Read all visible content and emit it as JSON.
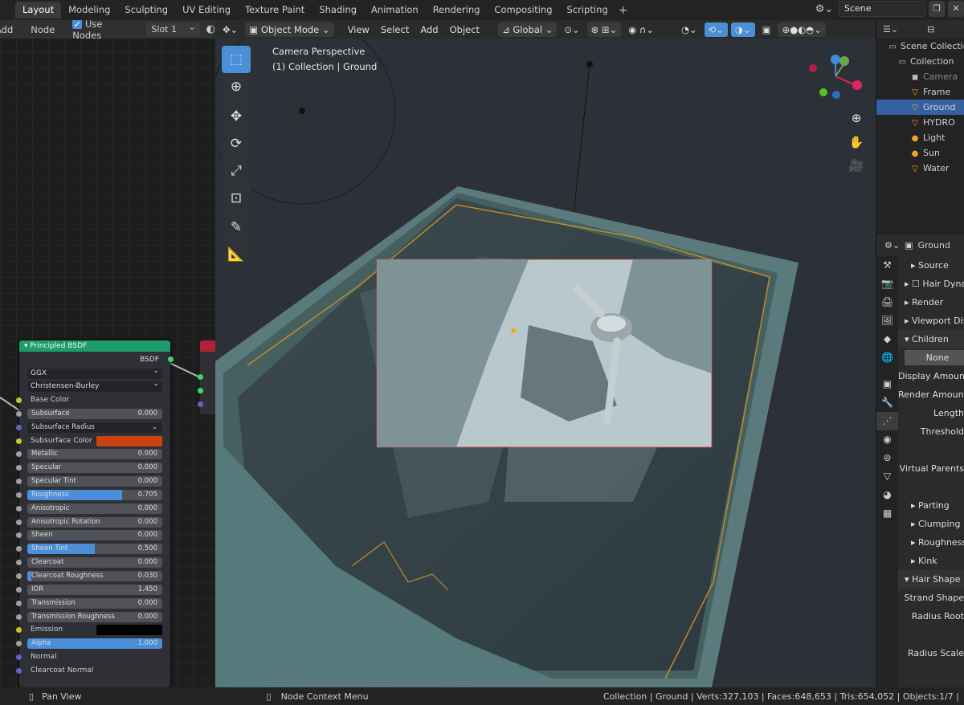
{
  "workspace_tabs": [
    "Layout",
    "Modeling",
    "Sculpting",
    "UV Editing",
    "Texture Paint",
    "Shading",
    "Animation",
    "Rendering",
    "Compositing",
    "Scripting"
  ],
  "active_tab": "Layout",
  "scene_name": "Scene",
  "node_editor": {
    "menu_add": "Add",
    "menu_node": "Node",
    "use_nodes_label": "Use Nodes",
    "slot": "Slot 1"
  },
  "node": {
    "title": "Principled BSDF",
    "output": "BSDF",
    "distribution": "GGX",
    "subsurface_method": "Christensen-Burley",
    "inputs": [
      {
        "type": "label",
        "label": "Base Color",
        "sock": "#c7c729"
      },
      {
        "type": "bar",
        "label": "Subsurface",
        "value": "0.000",
        "fill": 0,
        "sock": "#a1a1a1"
      },
      {
        "type": "dd",
        "label": "Subsurface Radius",
        "value": "",
        "sock": "#6363c7"
      },
      {
        "type": "color",
        "label": "Subsurface Color",
        "color": "#c9440f",
        "sock": "#c7c729"
      },
      {
        "type": "bar",
        "label": "Metallic",
        "value": "0.000",
        "fill": 0,
        "sock": "#a1a1a1"
      },
      {
        "type": "bar",
        "label": "Specular",
        "value": "0.000",
        "fill": 0,
        "sock": "#a1a1a1"
      },
      {
        "type": "bar",
        "label": "Specular Tint",
        "value": "0.000",
        "fill": 0,
        "sock": "#a1a1a1"
      },
      {
        "type": "bar",
        "label": "Roughness",
        "value": "0.705",
        "fill": 0.705,
        "sock": "#a1a1a1"
      },
      {
        "type": "bar",
        "label": "Anisotropic",
        "value": "0.000",
        "fill": 0,
        "sock": "#a1a1a1"
      },
      {
        "type": "bar",
        "label": "Anisotropic Rotation",
        "value": "0.000",
        "fill": 0,
        "sock": "#a1a1a1"
      },
      {
        "type": "bar",
        "label": "Sheen",
        "value": "0.000",
        "fill": 0,
        "sock": "#a1a1a1"
      },
      {
        "type": "bar",
        "label": "Sheen Tint",
        "value": "0.500",
        "fill": 0.5,
        "sock": "#a1a1a1"
      },
      {
        "type": "bar",
        "label": "Clearcoat",
        "value": "0.000",
        "fill": 0,
        "sock": "#a1a1a1"
      },
      {
        "type": "bar",
        "label": "Clearcoat Roughness",
        "value": "0.030",
        "fill": 0.03,
        "sock": "#a1a1a1"
      },
      {
        "type": "bar",
        "label": "IOR",
        "value": "1.450",
        "fill": 0,
        "sock": "#a1a1a1"
      },
      {
        "type": "bar",
        "label": "Transmission",
        "value": "0.000",
        "fill": 0,
        "sock": "#a1a1a1"
      },
      {
        "type": "bar",
        "label": "Transmission Roughness",
        "value": "0.000",
        "fill": 0,
        "sock": "#a1a1a1"
      },
      {
        "type": "color",
        "label": "Emission",
        "color": "#000000",
        "sock": "#c7c729"
      },
      {
        "type": "bar",
        "label": "Alpha",
        "value": "1.000",
        "fill": 1,
        "sock": "#a1a1a1"
      },
      {
        "type": "label",
        "label": "Normal",
        "sock": "#6363c7"
      },
      {
        "type": "label",
        "label": "Clearcoat Normal",
        "sock": "#6363c7"
      }
    ]
  },
  "viewport": {
    "mode": "Object Mode",
    "menu": [
      "View",
      "Select",
      "Add",
      "Object"
    ],
    "orientation": "Global",
    "perspective_label": "Camera Perspective",
    "collection_label": "(1) Collection | Ground"
  },
  "outliner": {
    "items": [
      {
        "label": "Scene Collection",
        "icon": "▭"
      },
      {
        "label": "Collection",
        "icon": "▭"
      },
      {
        "label": "Camera",
        "icon": "◼",
        "dim": true
      },
      {
        "label": "Frame",
        "icon": "▽"
      },
      {
        "label": "Ground",
        "icon": "▽",
        "selected": true
      },
      {
        "label": "HYDRO",
        "icon": "▽"
      },
      {
        "label": "Light",
        "icon": "●"
      },
      {
        "label": "Sun",
        "icon": "●"
      },
      {
        "label": "Water",
        "icon": "▽"
      }
    ]
  },
  "properties": {
    "object_name": "Ground",
    "rows": [
      {
        "label": "Source",
        "kind": "sub"
      },
      {
        "label": "Hair Dynamics",
        "kind": "check"
      },
      {
        "label": "Render",
        "kind": "sec"
      },
      {
        "label": "Viewport Display",
        "kind": "sec"
      },
      {
        "label": "Children",
        "kind": "open"
      },
      {
        "label": "None",
        "kind": "btn"
      },
      {
        "label": "Display Amount",
        "kind": "field"
      },
      {
        "label": "Render Amount",
        "kind": "field"
      },
      {
        "label": "Length",
        "kind": "field"
      },
      {
        "label": "Threshold",
        "kind": "field"
      },
      {
        "label": "",
        "kind": "blank"
      },
      {
        "label": "Virtual Parents",
        "kind": "field"
      },
      {
        "label": "",
        "kind": "blank"
      },
      {
        "label": "Parting",
        "kind": "sub"
      },
      {
        "label": "Clumping",
        "kind": "sub"
      },
      {
        "label": "Roughness",
        "kind": "sub"
      },
      {
        "label": "Kink",
        "kind": "sub"
      },
      {
        "label": "Hair Shape",
        "kind": "open"
      },
      {
        "label": "Strand Shape",
        "kind": "field"
      },
      {
        "label": "Radius Root",
        "kind": "field"
      },
      {
        "label": "",
        "kind": "blank"
      },
      {
        "label": "Radius Scale",
        "kind": "field"
      }
    ]
  },
  "status": {
    "pan_view": "Pan View",
    "context_menu": "Node Context Menu",
    "stats": "Collection | Ground | Verts:327,103 | Faces:648,653 | Tris:654,052 | Objects:1/7 |"
  }
}
